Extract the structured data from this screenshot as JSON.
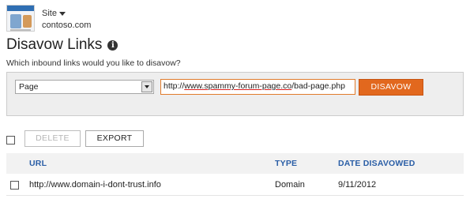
{
  "site": {
    "switch_label": "Site",
    "domain": "contoso.com"
  },
  "page": {
    "title": "Disavow Links",
    "question": "Which inbound links would you like to disavow?"
  },
  "form": {
    "scope_select_value": "Page",
    "url_value_prefix": "http://",
    "url_value_domain": "www.spammy-forum-page.co",
    "url_value_path": "/bad-page.php",
    "disavow_label": "DISAVOW"
  },
  "actions": {
    "delete_label": "DELETE",
    "export_label": "EXPORT"
  },
  "table": {
    "columns": [
      "URL",
      "TYPE",
      "DATE DISAVOWED"
    ],
    "rows": [
      {
        "url": "http://www.domain-i-dont-trust.info",
        "type": "Domain",
        "date": "9/11/2012"
      }
    ]
  },
  "colors": {
    "accent": "#e2681e",
    "header_link": "#2a5ea6"
  },
  "icons": {
    "info": "info-icon",
    "dropdown": "chevron-down-icon"
  }
}
